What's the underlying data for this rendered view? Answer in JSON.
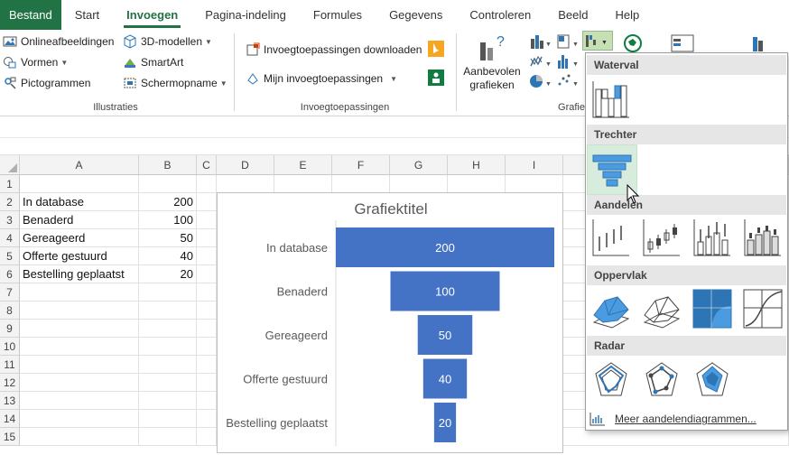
{
  "tabs": [
    "Bestand",
    "Start",
    "Invoegen",
    "Pagina-indeling",
    "Formules",
    "Gegevens",
    "Controleren",
    "Beeld",
    "Help"
  ],
  "ribbon": {
    "illustraties": {
      "online_images": "Onlineafbeeldingen",
      "models_3d": "3D-modellen",
      "shapes": "Vormen",
      "smartart": "SmartArt",
      "icons": "Pictogrammen",
      "screenshot": "Schermopname",
      "group_label": "Illustraties"
    },
    "invoegtoepassingen": {
      "download": "Invoegtoepassingen downloaden",
      "mine": "Mijn invoegtoepassingen",
      "group_label": "Invoegtoepassingen"
    },
    "grafieken": {
      "recommended_line1": "Aanbevolen",
      "recommended_line2": "grafieken",
      "group_label": "Grafie"
    }
  },
  "sheet": {
    "columns": [
      "A",
      "B",
      "C",
      "D",
      "E",
      "F",
      "G",
      "H",
      "I"
    ],
    "rows": [
      "1",
      "2",
      "3",
      "4",
      "5",
      "6",
      "7",
      "8",
      "9",
      "10",
      "11",
      "12",
      "13",
      "14",
      "15"
    ],
    "data": [
      {
        "label": "In database",
        "value": "200"
      },
      {
        "label": "Benaderd",
        "value": "100"
      },
      {
        "label": "Gereageerd",
        "value": "50"
      },
      {
        "label": "Offerte gestuurd",
        "value": "40"
      },
      {
        "label": "Bestelling geplaatst",
        "value": "20"
      }
    ]
  },
  "chart_data": {
    "type": "bar",
    "subtype": "funnel",
    "title": "Grafiektitel",
    "categories": [
      "In database",
      "Benaderd",
      "Gereageerd",
      "Offerte gestuurd",
      "Bestelling geplaatst"
    ],
    "values": [
      200,
      100,
      50,
      40,
      20
    ],
    "data_labels": [
      "200",
      "100",
      "50",
      "40",
      "20"
    ],
    "bar_color": "#4472c4",
    "xlim": [
      0,
      200
    ],
    "grid": false
  },
  "dropdown": {
    "sections": [
      "Waterval",
      "Trechter",
      "Aandelen",
      "Oppervlak",
      "Radar"
    ],
    "more": "Meer aandelendiagrammen...",
    "icons": [
      "waterfall-chart-icon",
      "funnel-chart-icon",
      "stock-hlc-icon",
      "stock-ohlc-icon",
      "stock-vhlc-icon",
      "stock-vohlc-icon",
      "surface-3d-icon",
      "wireframe-3d-icon",
      "contour-icon",
      "wireframe-contour-icon",
      "radar-icon",
      "radar-markers-icon",
      "filled-radar-icon"
    ]
  },
  "colors": {
    "excel_green": "#217346",
    "accent_blue": "#4472c4",
    "hover_green": "#d7ecdc"
  }
}
